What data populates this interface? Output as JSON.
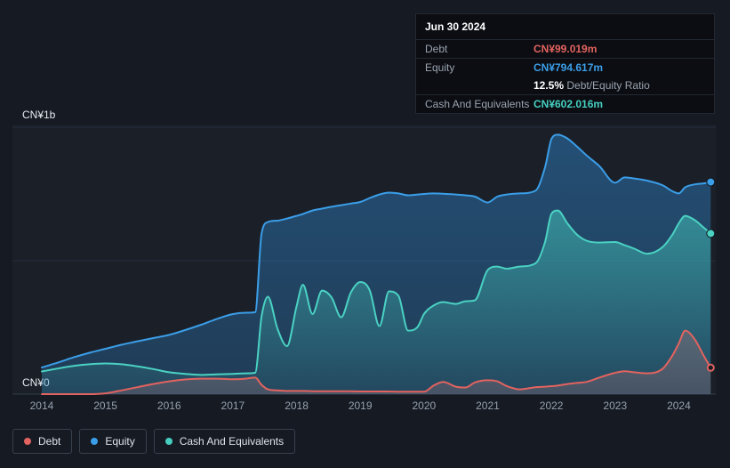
{
  "tooltip": {
    "date": "Jun 30 2024",
    "debt_label": "Debt",
    "debt_value": "CN¥99.019m",
    "equity_label": "Equity",
    "equity_value": "CN¥794.617m",
    "ratio_value": "12.5%",
    "ratio_label": "Debt/Equity Ratio",
    "cash_label": "Cash And Equivalents",
    "cash_value": "CN¥602.016m"
  },
  "legend": [
    {
      "label": "Debt",
      "color": "#E2635F"
    },
    {
      "label": "Equity",
      "color": "#3B9EE8"
    },
    {
      "label": "Cash And Equivalents",
      "color": "#46CFC0"
    }
  ],
  "chart_data": {
    "type": "area",
    "title": "Debt to Equity history",
    "unit": "CN¥ millions",
    "ylim": [
      0,
      1000
    ],
    "y_axis_labels": {
      "top": "CN¥1b",
      "bottom": "CN¥0"
    },
    "x_ticks": [
      "2014",
      "2015",
      "2016",
      "2017",
      "2018",
      "2019",
      "2020",
      "2021",
      "2022",
      "2023",
      "2024"
    ],
    "x_range": [
      2013.54,
      2024.58
    ],
    "gridlines": [
      0,
      500,
      1000
    ],
    "legend_position": "bottom-left",
    "x": [
      2014,
      2014.25,
      2014.5,
      2014.75,
      2015,
      2015.25,
      2015.5,
      2015.75,
      2016,
      2016.25,
      2016.5,
      2016.75,
      2017,
      2017.2,
      2017.35,
      2017.45,
      2017.55,
      2017.7,
      2017.85,
      2018,
      2018.1,
      2018.25,
      2018.4,
      2018.55,
      2018.7,
      2018.85,
      2019,
      2019.15,
      2019.3,
      2019.45,
      2019.6,
      2019.75,
      2019.9,
      2020,
      2020.15,
      2020.3,
      2020.5,
      2020.65,
      2020.8,
      2021,
      2021.15,
      2021.3,
      2021.5,
      2021.75,
      2021.9,
      2022,
      2022.1,
      2022.25,
      2022.4,
      2022.55,
      2022.75,
      2023,
      2023.15,
      2023.3,
      2023.5,
      2023.75,
      2023.9,
      2024,
      2024.1,
      2024.25,
      2024.4,
      2024.5
    ],
    "series": [
      {
        "name": "Debt",
        "color": "#E2635F",
        "fill": "#C47A7A",
        "fill_opacity": [
          0.3,
          0.22
        ],
        "values": [
          0,
          0,
          0,
          0,
          3,
          14,
          26,
          38,
          48,
          55,
          58,
          58,
          56,
          58,
          62,
          35,
          18,
          14,
          12,
          12,
          12,
          11,
          11,
          11,
          11,
          11,
          10,
          10,
          10,
          10,
          9,
          9,
          9,
          9,
          32,
          46,
          28,
          25,
          44,
          52,
          48,
          30,
          18,
          26,
          28,
          30,
          32,
          38,
          42,
          46,
          62,
          80,
          86,
          82,
          78,
          96,
          145,
          190,
          238,
          205,
          140,
          99.019
        ]
      },
      {
        "name": "Equity",
        "color": "#3B9EE8",
        "fill": "#2E7FC2",
        "fill_opacity": [
          0.5,
          0.3
        ],
        "values": [
          100,
          118,
          138,
          155,
          170,
          185,
          198,
          210,
          222,
          240,
          260,
          282,
          300,
          305,
          307,
          600,
          645,
          650,
          658,
          668,
          675,
          688,
          695,
          702,
          708,
          714,
          720,
          735,
          748,
          755,
          752,
          745,
          748,
          750,
          752,
          751,
          748,
          745,
          740,
          718,
          740,
          748,
          752,
          762,
          850,
          955,
          972,
          958,
          928,
          895,
          855,
          792,
          812,
          808,
          800,
          782,
          760,
          752,
          775,
          786,
          790,
          794.617
        ]
      },
      {
        "name": "Cash And Equivalents",
        "color": "#4AD2C3",
        "fill": "#46CFC0",
        "fill_opacity": [
          0.5,
          0.08
        ],
        "values": [
          85,
          96,
          106,
          112,
          115,
          112,
          104,
          94,
          82,
          76,
          72,
          74,
          76,
          78,
          80,
          290,
          365,
          245,
          180,
          330,
          410,
          300,
          388,
          362,
          288,
          380,
          420,
          388,
          255,
          385,
          368,
          238,
          252,
          300,
          332,
          345,
          338,
          348,
          352,
          465,
          478,
          470,
          478,
          490,
          570,
          675,
          688,
          640,
          598,
          575,
          568,
          570,
          558,
          545,
          526,
          552,
          598,
          640,
          668,
          652,
          622,
          602.016
        ]
      }
    ],
    "paint_order": [
      1,
      2,
      0
    ],
    "end_markers": {
      "Debt": "ring",
      "Equity": "dot",
      "Cash And Equivalents": "dot"
    }
  }
}
